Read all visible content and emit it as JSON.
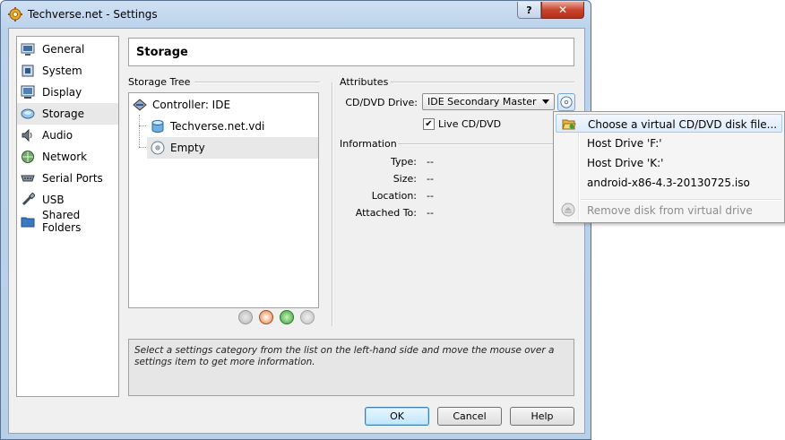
{
  "window": {
    "title": "Techverse.net - Settings",
    "help_glyph": "?",
    "close_glyph": "✕"
  },
  "sidebar": {
    "items": [
      {
        "label": "General",
        "icon": "monitor-icon"
      },
      {
        "label": "System",
        "icon": "chip-icon"
      },
      {
        "label": "Display",
        "icon": "display-icon"
      },
      {
        "label": "Storage",
        "icon": "disk-icon",
        "selected": true
      },
      {
        "label": "Audio",
        "icon": "speaker-icon"
      },
      {
        "label": "Network",
        "icon": "network-icon"
      },
      {
        "label": "Serial Ports",
        "icon": "serial-port-icon"
      },
      {
        "label": "USB",
        "icon": "usb-icon"
      },
      {
        "label": "Shared Folders",
        "icon": "folder-icon"
      }
    ]
  },
  "page": {
    "title": "Storage"
  },
  "storage_tree": {
    "label": "Storage Tree",
    "controller": "Controller: IDE",
    "items": [
      {
        "label": "Techverse.net.vdi",
        "icon": "hard-disk-icon"
      },
      {
        "label": "Empty",
        "icon": "optical-disk-icon",
        "selected": true
      }
    ]
  },
  "attributes": {
    "label": "Attributes",
    "drive_label": "CD/DVD Drive:",
    "drive_value": "IDE Secondary Master",
    "live_cd_label": "Live CD/DVD",
    "live_cd_checked": true,
    "check_glyph": "✔"
  },
  "information": {
    "label": "Information",
    "rows": [
      {
        "key": "Type:",
        "value": "--"
      },
      {
        "key": "Size:",
        "value": "--"
      },
      {
        "key": "Location:",
        "value": "--"
      },
      {
        "key": "Attached To:",
        "value": "--"
      }
    ]
  },
  "description": "Select a settings category from the list on the left-hand side and move the mouse over a settings item to get more information.",
  "buttons": {
    "ok": "OK",
    "cancel": "Cancel",
    "help": "Help"
  },
  "menu": {
    "items": [
      {
        "label": "Choose a virtual CD/DVD disk file...",
        "icon": "folder-open-icon"
      },
      {
        "label": "Host Drive 'F:'"
      },
      {
        "label": "Host Drive 'K:'"
      },
      {
        "label": "android-x86-4.3-20130725.iso"
      },
      {
        "label": "Remove disk from virtual drive",
        "icon": "eject-icon",
        "disabled": true
      }
    ]
  },
  "colors": {
    "selection": "#e8e8e8",
    "menu_hover": "#dcebfc",
    "title_bar": "#bcd3ec"
  }
}
